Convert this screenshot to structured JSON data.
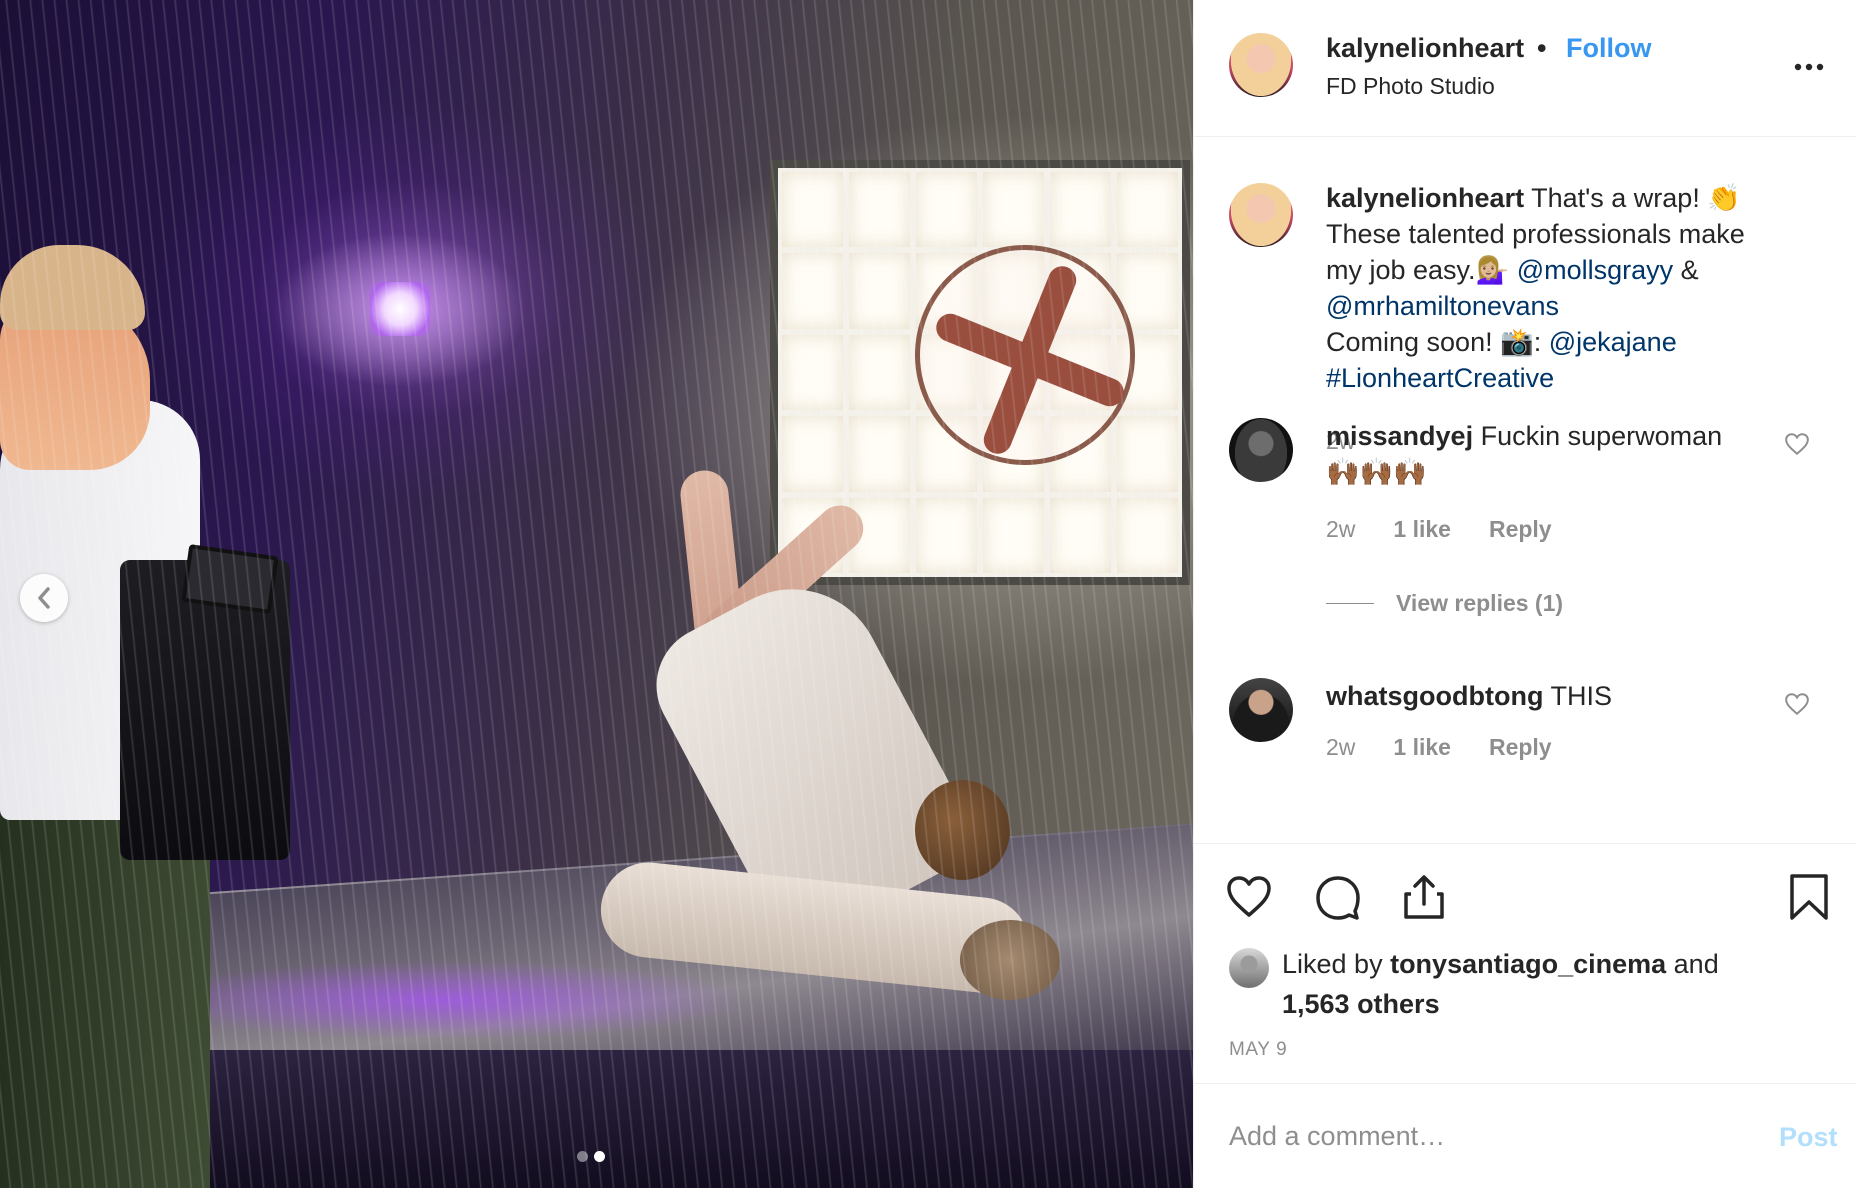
{
  "post": {
    "author": "kalynelionheart",
    "separator": "•",
    "follow_label": "Follow",
    "location": "FD Photo Studio",
    "caption": {
      "username": "kalynelionheart",
      "line1": " That's a wrap! 👏",
      "line2": "These talented professionals make",
      "line3_prefix": "my job easy.💁🏼‍♀️ ",
      "mention1": "@mollsgrayy",
      "amp": " &",
      "mention2": "@mrhamiltonevans",
      "line5_prefix": "Coming soon! 📸: ",
      "mention3": "@jekajane",
      "hashtag": "#LionheartCreative",
      "time": "2w"
    },
    "comments": [
      {
        "username": "missandyej",
        "text": " Fuckin superwoman",
        "emoji_line": "🙌🏾🙌🏾🙌🏾",
        "time": "2w",
        "likes": "1 like",
        "reply": "Reply",
        "view_replies": "View replies (1)"
      },
      {
        "username": "whatsgoodbtong",
        "text": " THIS",
        "time": "2w",
        "likes": "1 like",
        "reply": "Reply"
      }
    ],
    "likes": {
      "prefix": "Liked by ",
      "liker": "tonysantiago_cinema",
      "middle": " and",
      "others": "1,563 others"
    },
    "date": "MAY 9",
    "add_comment_placeholder": "Add a comment…",
    "post_button": "Post"
  },
  "icons": {
    "more": "more-options-icon",
    "like": "heart-icon",
    "comment": "comment-icon",
    "share": "share-icon",
    "save": "bookmark-icon",
    "prev": "chevron-left-icon"
  },
  "carousel": {
    "count": 2,
    "active_index": 1
  },
  "colors": {
    "link_blue": "#3897f0",
    "mention_blue": "#003569",
    "muted": "#8e8e8e",
    "post_disabled": "#b2dffc"
  }
}
